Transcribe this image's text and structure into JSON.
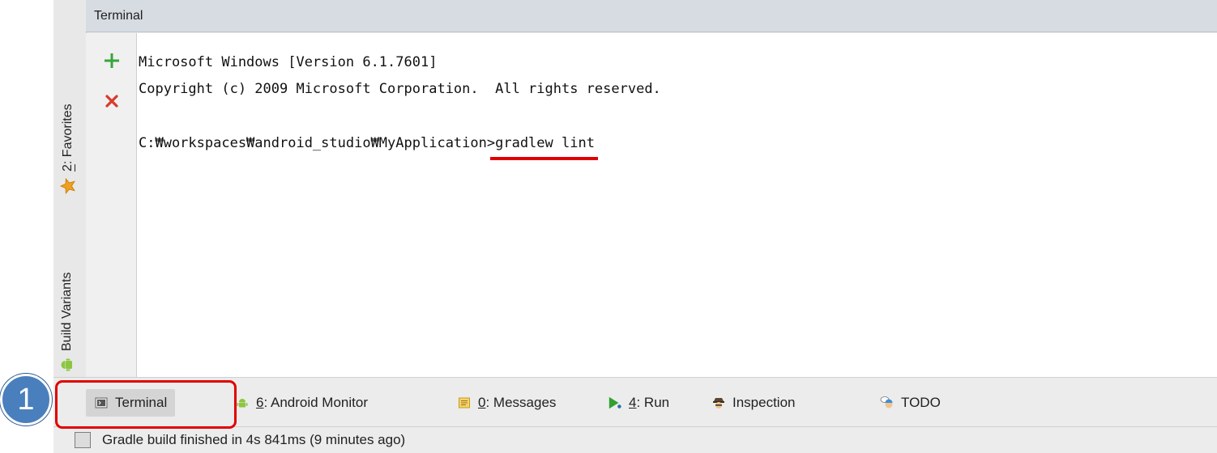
{
  "panel": {
    "title": "Terminal",
    "add_label": "+",
    "close_label": "✕"
  },
  "left_tabs": {
    "favorites": {
      "prefix": "2",
      "label": ": Favorites",
      "icon": "star-icon"
    },
    "build_variants": {
      "label": "Build Variants",
      "icon": "android-icon"
    }
  },
  "console": {
    "lines": [
      "Microsoft Windows [Version 6.1.7601]",
      "Copyright (c) 2009 Microsoft Corporation.  All rights reserved.",
      "",
      "C:₩workspaces₩android_studio₩MyApplication>"
    ],
    "command": "gradlew lint"
  },
  "tool_windows": [
    {
      "label": "Terminal",
      "icon": "terminal-icon",
      "active": true
    },
    {
      "prefix": "6",
      "label": ": Android Monitor",
      "icon": "android-icon"
    },
    {
      "prefix": "0",
      "label": ": Messages",
      "icon": "messages-icon"
    },
    {
      "prefix": "4",
      "label": ": Run",
      "icon": "run-icon"
    },
    {
      "label": "Inspection",
      "icon": "inspection-icon"
    },
    {
      "label": "TODO",
      "icon": "todo-icon"
    }
  ],
  "status": {
    "text": "Gradle build finished in 4s 841ms (9 minutes ago)"
  },
  "annotation": {
    "badge": "1",
    "color": "#e10000"
  }
}
